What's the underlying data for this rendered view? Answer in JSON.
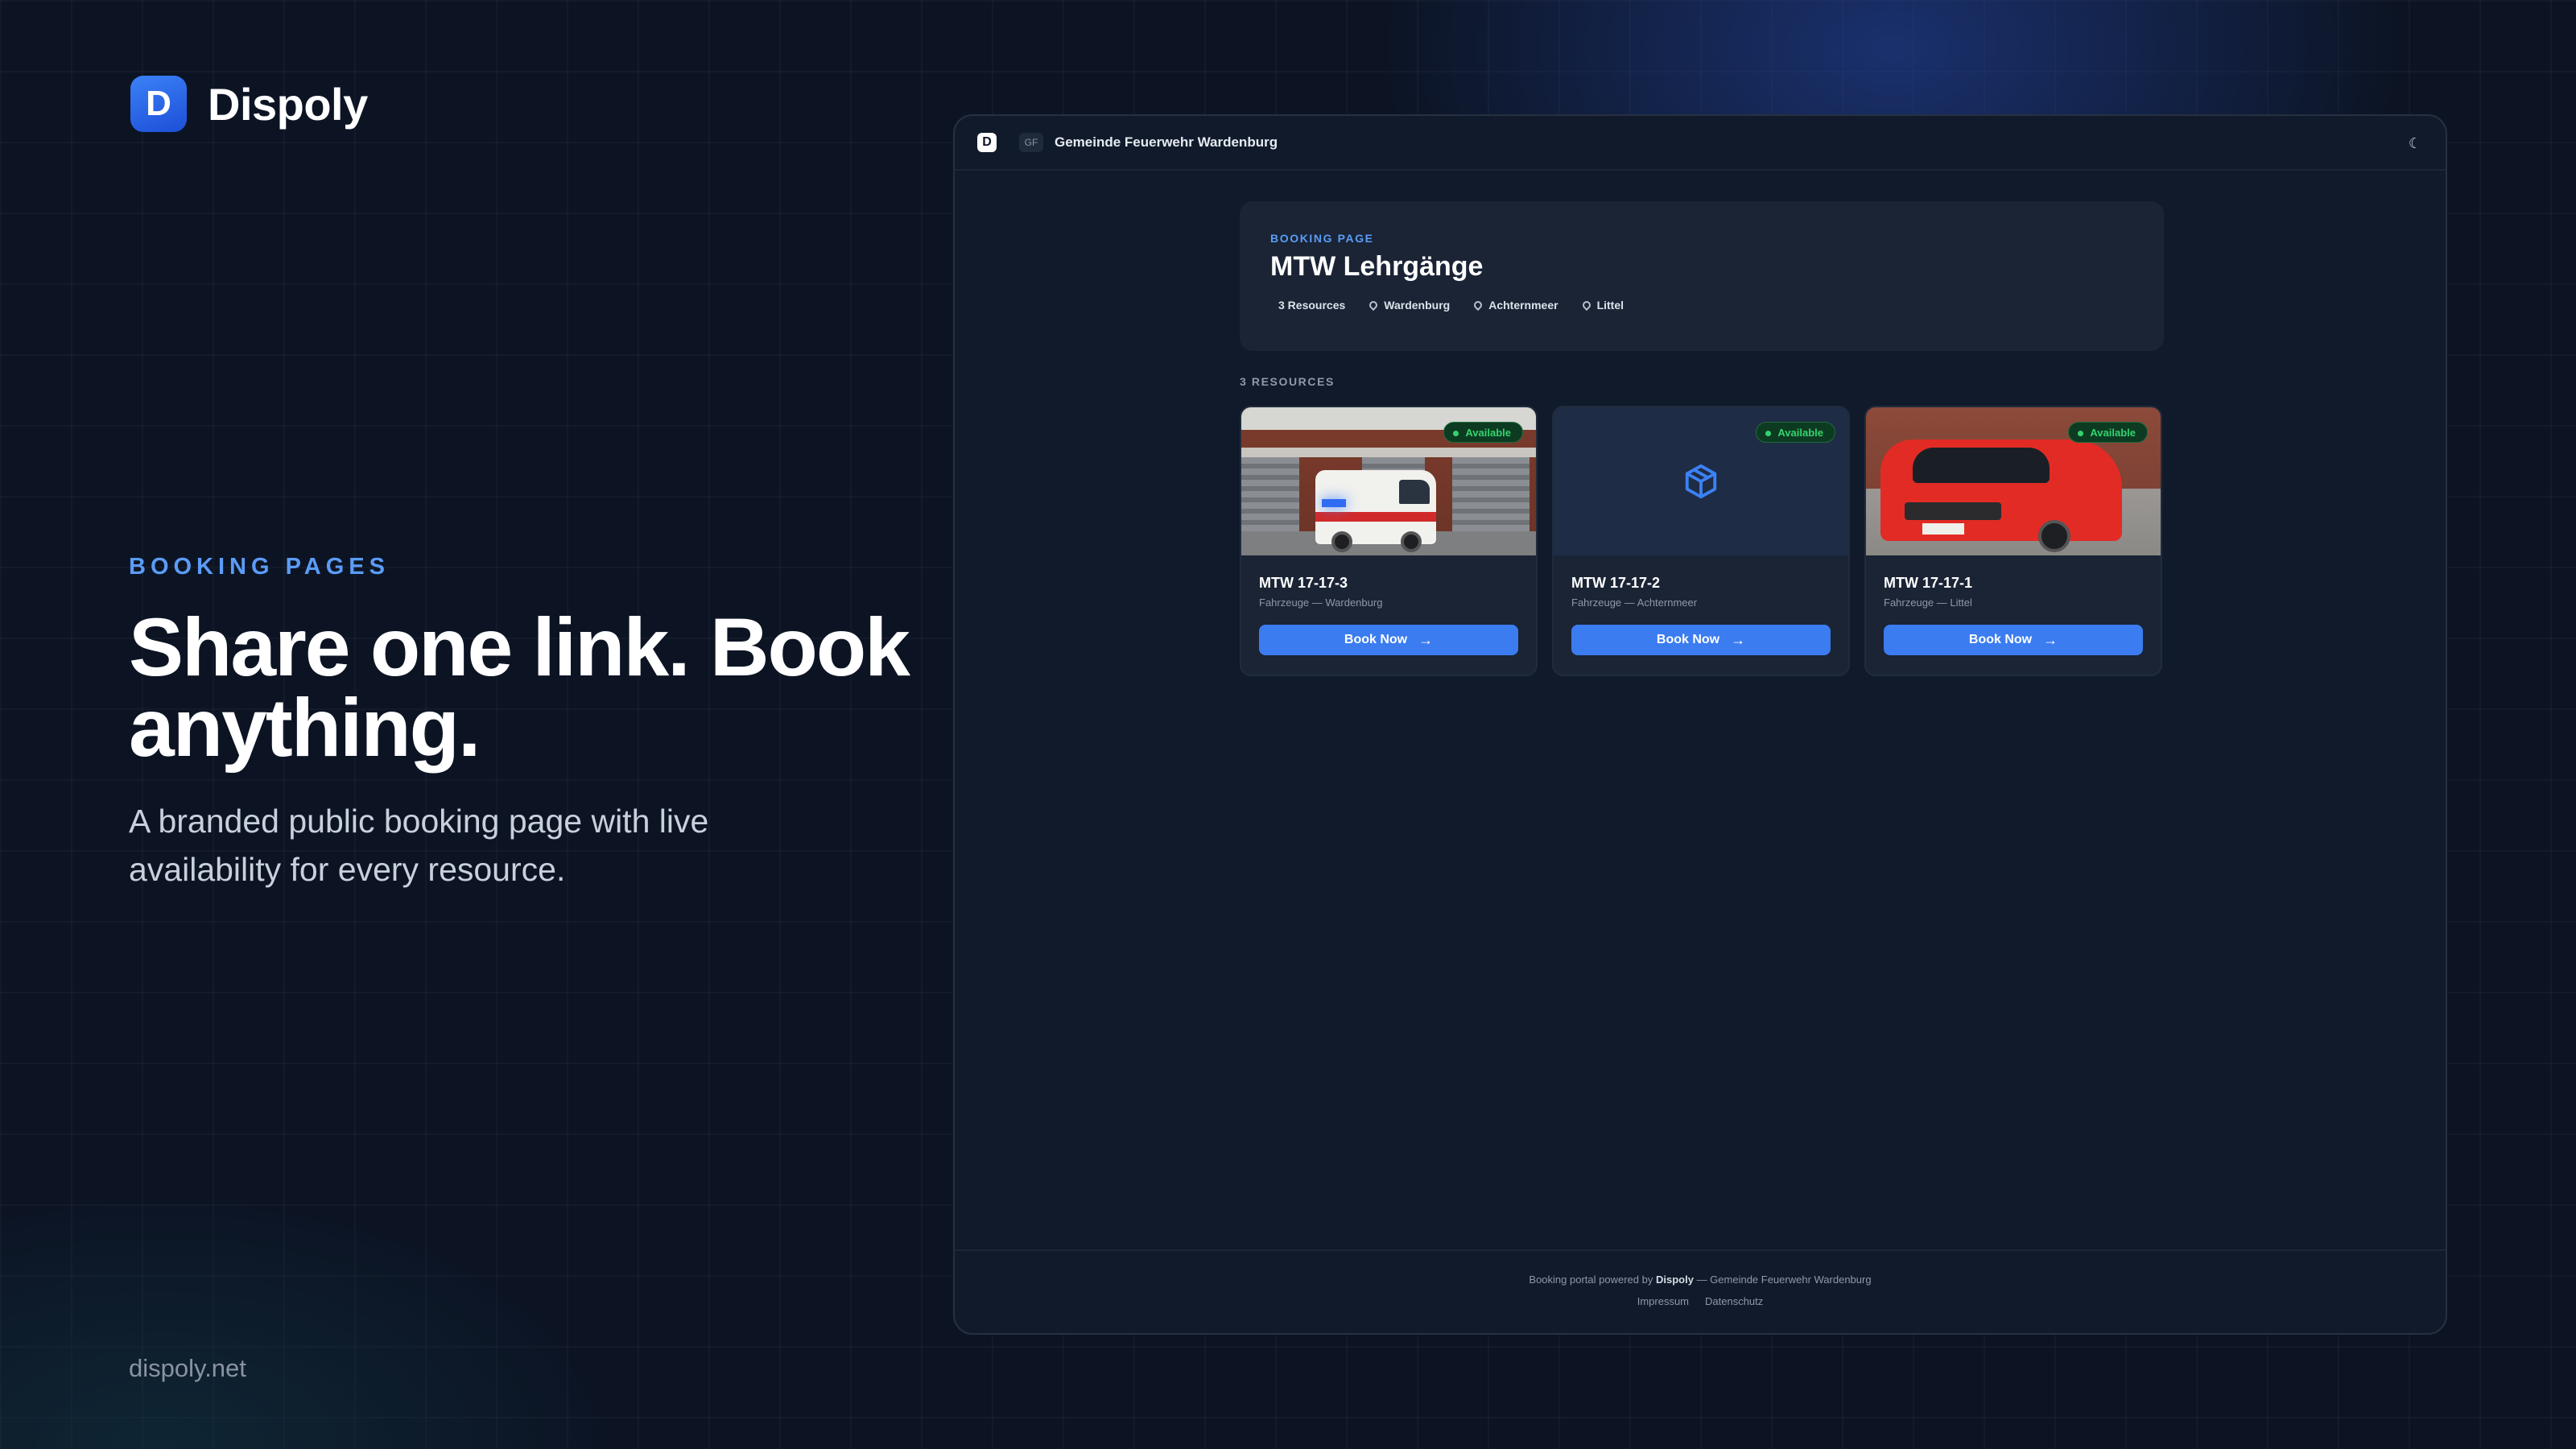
{
  "brand": {
    "logo_letter": "D",
    "name": "Dispoly"
  },
  "hero": {
    "eyebrow": "BOOKING PAGES",
    "headline": "Share one link. Book anything.",
    "subline": "A branded public booking page with live availability for every resource.",
    "site": "dispoly.net"
  },
  "window": {
    "topbar": {
      "logo_letter": "D",
      "initials": "GF",
      "org_name": "Gemeinde Feuerwehr Wardenburg",
      "theme_icon": "moon-icon"
    },
    "header": {
      "kicker": "BOOKING PAGE",
      "title": "MTW Lehrgänge",
      "meta": [
        "3 Resources",
        "Wardenburg",
        "Achternmeer",
        "Littel"
      ]
    },
    "resources_label": "3 RESOURCES",
    "resources": [
      {
        "name": "MTW 17-17-3",
        "subtitle": "Fahrzeuge — Wardenburg",
        "status": "Available",
        "button": "Book Now",
        "image": "ambulance-photo"
      },
      {
        "name": "MTW 17-17-2",
        "subtitle": "Fahrzeuge — Achternmeer",
        "status": "Available",
        "button": "Book Now",
        "image": "box-icon"
      },
      {
        "name": "MTW 17-17-1",
        "subtitle": "Fahrzeuge — Littel",
        "status": "Available",
        "button": "Book Now",
        "image": "red-van-photo"
      }
    ],
    "footer": {
      "prefix": "Booking portal powered by",
      "brand": "Dispoly",
      "suffix": "— Gemeinde Feuerwehr Wardenburg",
      "links": [
        "Impressum",
        "Datenschutz"
      ]
    }
  },
  "colors": {
    "accent": "#3b7cf0",
    "available": "#34d36f",
    "background": "#0c1424",
    "panel": "#1a2435"
  }
}
